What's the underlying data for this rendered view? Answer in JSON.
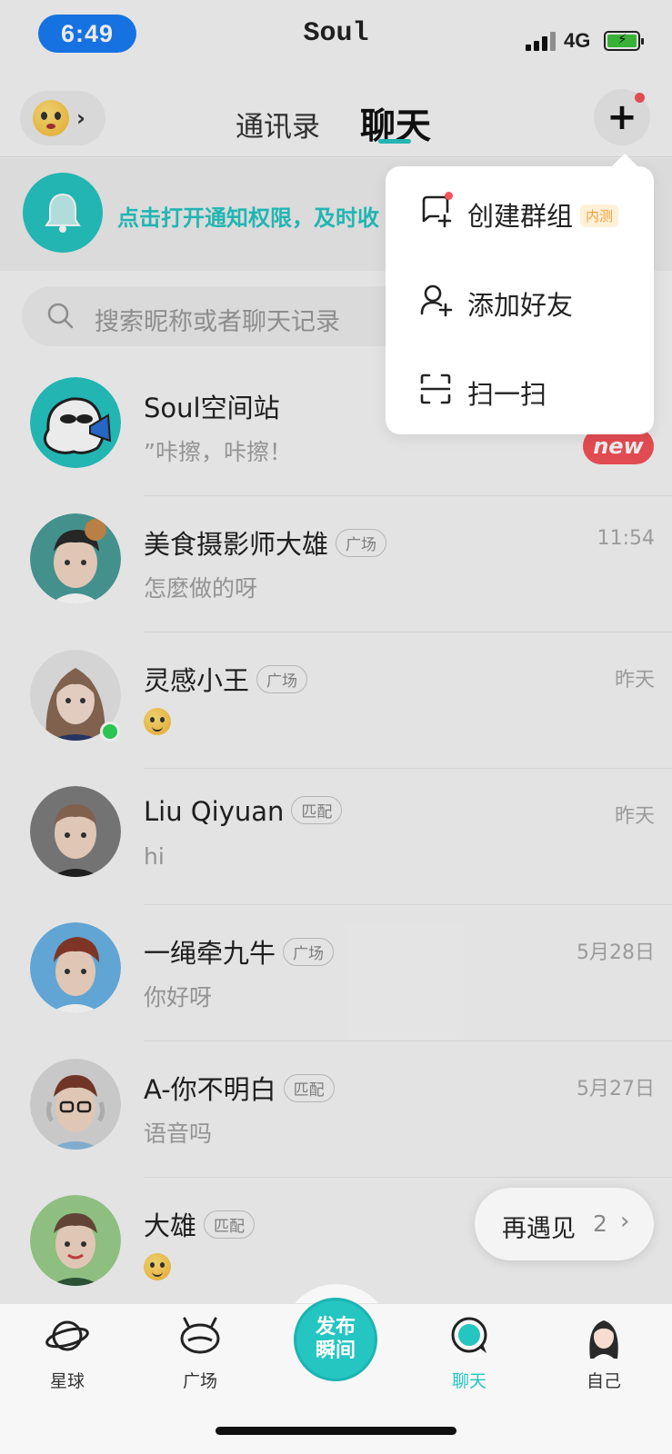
{
  "status_bar": {
    "time": "6:49",
    "app_name": "Soul",
    "network": "4G"
  },
  "header": {
    "mood_icon": "emoji-face-icon",
    "tabs": [
      {
        "label": "通讯录",
        "active": false
      },
      {
        "label": "聊天",
        "active": true
      }
    ],
    "plus_label": "+"
  },
  "notify_banner": {
    "text": "点击打开通知权限，及时收"
  },
  "search": {
    "placeholder": "搜索昵称或者聊天记录"
  },
  "popup_menu": {
    "items": [
      {
        "label": "创建群组",
        "badge": "内测",
        "icon": "group-chat-add-icon"
      },
      {
        "label": "添加好友",
        "icon": "add-friend-icon"
      },
      {
        "label": "扫一扫",
        "icon": "scan-icon"
      }
    ]
  },
  "chats": [
    {
      "name": "Soul空间站",
      "tag": "",
      "time": "",
      "message": "”咔擦，咔擦！",
      "badge": "new"
    },
    {
      "name": "美食摄影师大雄",
      "tag": "广场",
      "time": "11:54",
      "message": "怎麼做的呀"
    },
    {
      "name": "灵感小王",
      "tag": "广场",
      "time": "昨天",
      "message": "",
      "message_emoji": "emoji-icon",
      "online": true
    },
    {
      "name": "Liu Qiyuan",
      "tag": "匹配",
      "time": "昨天",
      "message": "hi"
    },
    {
      "name": "一绳牵九牛",
      "tag": "广场",
      "time": "5月28日",
      "message": "你好呀"
    },
    {
      "name": "A-你不明白",
      "tag": "匹配",
      "time": "5月27日",
      "message": "语音吗"
    },
    {
      "name": "大雄",
      "tag": "匹配",
      "time": "",
      "message": "",
      "message_emoji": "smile-emoji-icon"
    }
  ],
  "meet_again": {
    "label": "再遇见",
    "count": "2",
    "chevron": "›"
  },
  "bottom_nav": {
    "items": [
      {
        "label": "星球",
        "icon": "planet-icon"
      },
      {
        "label": "广场",
        "icon": "square-icon"
      },
      {
        "label": "聊天",
        "icon": "chat-icon",
        "active": true
      },
      {
        "label": "自己",
        "icon": "profile-avatar-icon"
      }
    ],
    "publish_line1": "发布",
    "publish_line2": "瞬间"
  },
  "colors": {
    "accent": "#25c5c2",
    "badge_red": "#f5525a",
    "time_pill": "#1a7cf5"
  }
}
